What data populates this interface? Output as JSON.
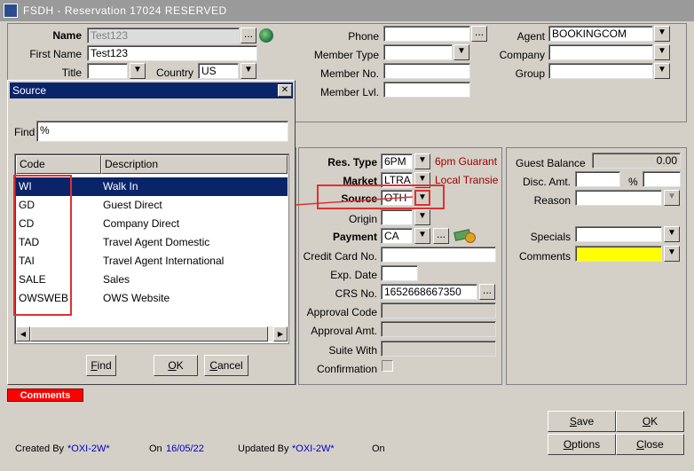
{
  "window": {
    "title": "FSDH - Reservation 17024  RESERVED"
  },
  "guest": {
    "name_label": "Name",
    "name_value": "Test123",
    "first_name_label": "First Name",
    "first_name_value": "Test123",
    "title_label": "Title",
    "title_value": "",
    "country_label": "Country",
    "country_value": "US",
    "phone_label": "Phone",
    "phone_value": "",
    "member_type_label": "Member Type",
    "member_type_value": "",
    "member_no_label": "Member No.",
    "member_no_value": "",
    "member_lvl_label": "Member Lvl.",
    "member_lvl_value": "",
    "agent_label": "Agent",
    "agent_value": "BOOKINGCOM",
    "company_label": "Company",
    "company_value": "",
    "group_label": "Group",
    "group_value": ""
  },
  "reservation": {
    "res_type_label": "Res. Type",
    "res_type_value": "6PM",
    "res_type_desc": "6pm Guarant",
    "market_label": "Market",
    "market_value": "LTRA",
    "market_desc": "Local Transie",
    "source_label": "Source",
    "source_value": "OTH",
    "origin_label": "Origin",
    "origin_value": "",
    "payment_label": "Payment",
    "payment_value": "CA",
    "credit_card_label": "Credit Card No.",
    "credit_card_value": "",
    "exp_date_label": "Exp. Date",
    "exp_date_value": "",
    "crs_label": "CRS No.",
    "crs_value": "1652668667350",
    "approval_code_label": "Approval Code",
    "approval_amt_label": "Approval Amt.",
    "suite_with_label": "Suite With",
    "confirmation_label": "Confirmation"
  },
  "balance": {
    "guest_balance_label": "Guest Balance",
    "guest_balance_value": "0.00",
    "disc_amt_label": "Disc. Amt.",
    "percent_label": "%",
    "reason_label": "Reason",
    "specials_label": "Specials",
    "comments_label": "Comments"
  },
  "comments_tab": "Comments",
  "footer": {
    "created_by_label": "Created By",
    "created_by_value": "*OXI-2W*",
    "on_label": "On",
    "created_on_value": "16/05/22",
    "updated_by_label": "Updated By",
    "updated_by_value": "*OXI-2W*",
    "on2_label": "On"
  },
  "buttons": {
    "save": "Save",
    "ok": "OK",
    "options": "Options",
    "close": "Close",
    "ellipsis": "..."
  },
  "source_dialog": {
    "title": "Source",
    "close_glyph": "✕",
    "find_label": "Find",
    "find_value": "%",
    "col_code": "Code",
    "col_description": "Description",
    "rows": [
      {
        "code": "WI",
        "description": "Walk In"
      },
      {
        "code": "GD",
        "description": "Guest Direct"
      },
      {
        "code": "CD",
        "description": "Company Direct"
      },
      {
        "code": "TAD",
        "description": "Travel Agent Domestic"
      },
      {
        "code": "TAI",
        "description": "Travel Agent International"
      },
      {
        "code": "SALE",
        "description": "Sales"
      },
      {
        "code": "OWSWEB",
        "description": "OWS Website"
      }
    ],
    "find_button": "Find",
    "ok_button": "OK",
    "cancel_button": "Cancel"
  },
  "colors": {
    "highlight": "#e03030",
    "selection": "#0a246a",
    "comments_tab": "#ff0000"
  }
}
